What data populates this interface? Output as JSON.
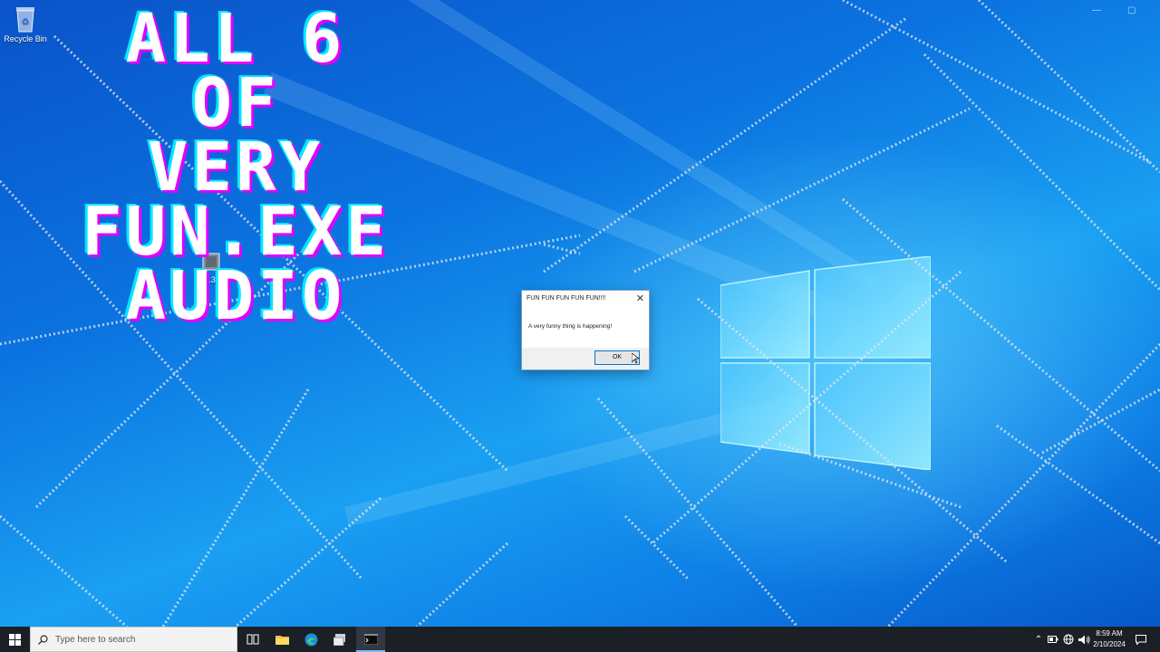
{
  "overlay": {
    "lines": [
      "ALL 6",
      "OF",
      "VERY",
      "FUN.EXE",
      "AUDIO"
    ]
  },
  "desktop": {
    "icons": [
      {
        "label": "Recycle Bin",
        "icon": "recycle-bin-icon"
      },
      {
        "label": "j...32",
        "icon": "program-icon"
      }
    ]
  },
  "dialog": {
    "title": "FUN FUN FUN FUN FUN!!!!",
    "message": "A very funny thing is happening!",
    "ok_label": "OK",
    "close_glyph": "✕"
  },
  "taskbar": {
    "search_placeholder": "Type here to search",
    "clock_time": "8:59 AM",
    "clock_date": "2/10/2024",
    "pinned": [
      "start-icon",
      "task-view-icon",
      "file-explorer-icon",
      "edge-icon",
      "app-icon",
      "terminal-icon"
    ],
    "tray": [
      "chevron-up-icon",
      "battery-icon",
      "network-icon",
      "volume-icon",
      "notification-icon"
    ]
  },
  "colors": {
    "wallpaper_blue": "#0b74e0",
    "overlay_magenta": "#e100ff",
    "overlay_cyan": "#00e8ff",
    "taskbar": "#1b1f26",
    "ok_border": "#0078d7"
  }
}
